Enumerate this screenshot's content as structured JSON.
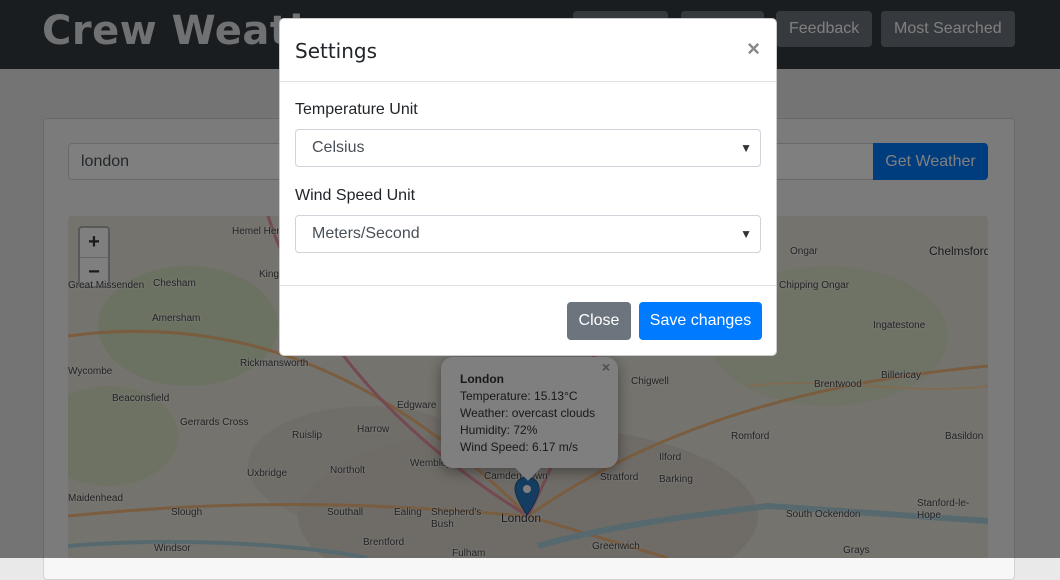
{
  "navbar": {
    "brand": "Crew Weather",
    "buttons": [
      "Feedback",
      "Most Searched"
    ]
  },
  "search": {
    "value": "london",
    "button": "Get Weather"
  },
  "map": {
    "zoom_in": "+",
    "zoom_out": "−",
    "places": [
      "Chelmsford",
      "Hemel Hempstead",
      "Kings Langley",
      "Great Missenden",
      "Chesham",
      "Amersham",
      "Rickmansworth",
      "Ongar",
      "Chipping Ongar",
      "Ingatestone",
      "Billericay",
      "Brentwood",
      "Chigwell",
      "Romford",
      "Basildon",
      "Beaconsfield",
      "Gerrards Cross",
      "Ruislip",
      "Harrow",
      "Edgware",
      "Wembley",
      "Northolt",
      "Uxbridge",
      "Ilford",
      "Barking",
      "Stratford",
      "Camden Town",
      "Maidenhead",
      "Slough",
      "Southall",
      "Ealing",
      "Shepherd's Bush",
      "London",
      "South Ockendon",
      "Stanford-le-Hope",
      "Windsor",
      "Brentford",
      "Fulham",
      "Greenwich",
      "Grays",
      "Wycombe"
    ]
  },
  "popup": {
    "city": "London",
    "temperature": "Temperature: 15.13°C",
    "weather": "Weather: overcast clouds",
    "humidity": "Humidity: 72%",
    "wind": "Wind Speed: 6.17 m/s",
    "close": "×"
  },
  "modal": {
    "title": "Settings",
    "close_x": "×",
    "temp_label": "Temperature Unit",
    "temp_value": "Celsius",
    "wind_label": "Wind Speed Unit",
    "wind_value": "Meters/Second",
    "close_button": "Close",
    "save_button": "Save changes"
  }
}
